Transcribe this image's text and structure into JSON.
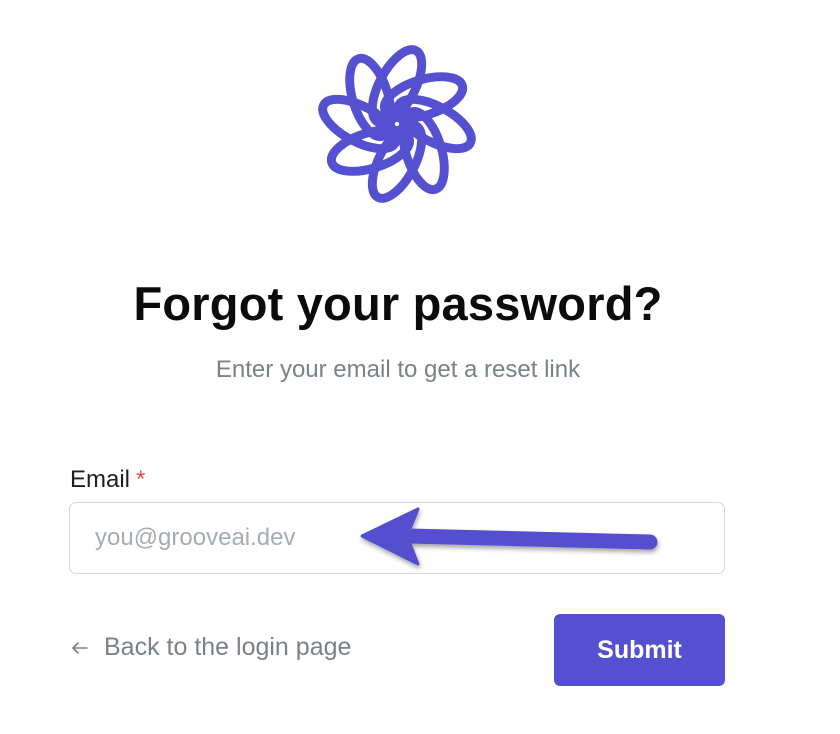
{
  "brand": {
    "logo_icon": "flower-logo-icon",
    "accent_color": "#5450cf"
  },
  "heading": {
    "title": "Forgot your password?",
    "subtitle": "Enter your email to get a reset link"
  },
  "form": {
    "email_label": "Email",
    "required_marker": "*",
    "email_value": "",
    "email_placeholder": "you@grooveai.dev",
    "back_link_label": "Back to the login page",
    "back_icon": "arrow-left-icon",
    "submit_label": "Submit"
  },
  "annotation": {
    "pointer_icon": "annotation-arrow-icon"
  }
}
